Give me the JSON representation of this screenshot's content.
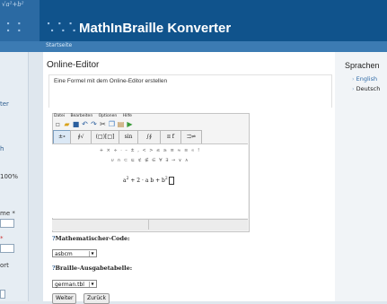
{
  "header": {
    "logo_formula": "√a²+b²",
    "logo_braille": "⠨⠨",
    "braille_prefix": "⠡⠡⠡",
    "title": "MathInBraille Konverter"
  },
  "breadcrumb": "Startseite",
  "left_sidebar": {
    "items": [
      "ter",
      "h",
      "100%",
      "me *",
      "*",
      "ort"
    ]
  },
  "main": {
    "page_title": "Online-Editor",
    "section_label": "Eine Formel mit dem Online-Editor erstellen"
  },
  "editor": {
    "menu": [
      "Datei",
      "Bearbeiten",
      "Optionen",
      "Hilfe"
    ],
    "toolbar_icons": [
      "new-icon",
      "open-icon",
      "save-icon",
      "undo-icon",
      "redo-icon",
      "cut-icon",
      "copy-icon",
      "paste-icon",
      "help-icon"
    ],
    "tabs": [
      "±∘ ≥∪",
      "∮√",
      "(□)[□]",
      "sin",
      "∫∮",
      "π f",
      "⇉⇌"
    ],
    "symbol_row1": "+ × ÷ · – ± , < > ≤ ≥ ≡ ≈ ≅ ∝ !",
    "symbol_row2": "∪ ∩ ⊂ ⊆ ⊄ ∉ ∈ ∀ ∃ → ∨ ∧",
    "formula_base": "a",
    "formula_exp": "2",
    "formula_rest": "+ 2 · a b + b",
    "formula_exp2": "2"
  },
  "form": {
    "math_code_label": "Mathematischer-Code:",
    "math_code_value": "asbcm",
    "braille_table_label": "Braille-Ausgabetabelle:",
    "braille_table_value": "german.tbl",
    "next_button": "Weiter",
    "back_button": "Zurück",
    "help_marker": "?"
  },
  "right_sidebar": {
    "title": "Sprachen",
    "languages": [
      "English",
      "Deutsch"
    ]
  },
  "colors": {
    "header_bg": "#10538c",
    "link": "#2f5e8f"
  }
}
